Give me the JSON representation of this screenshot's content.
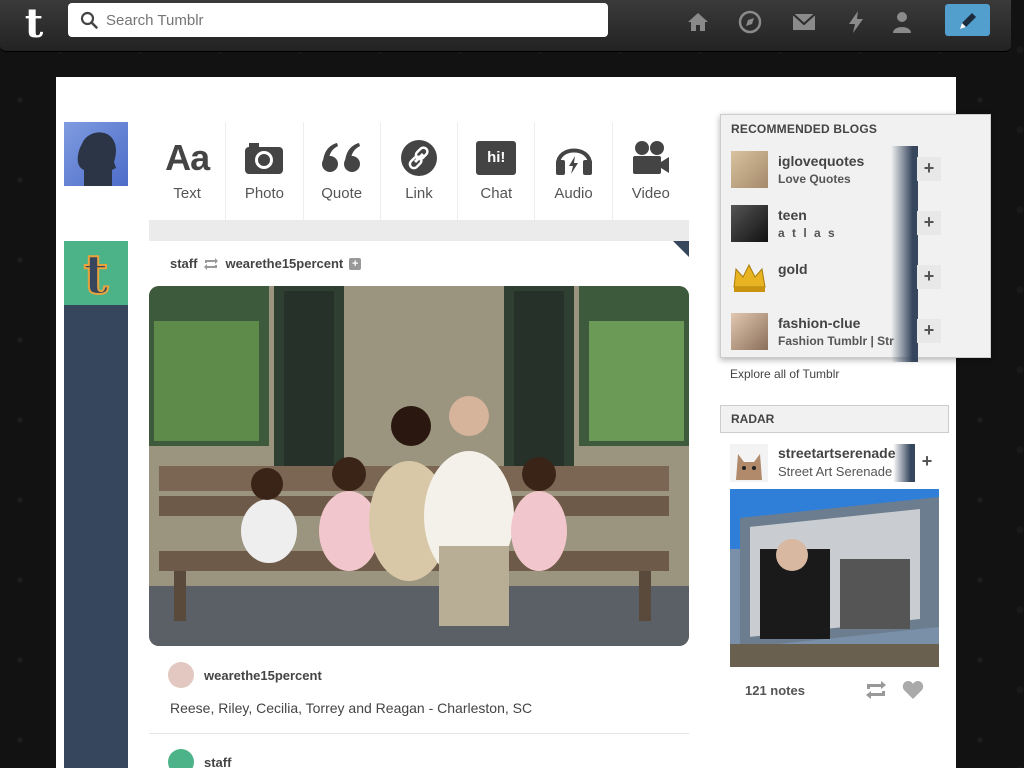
{
  "header": {
    "logo": "t",
    "search_placeholder": "Search Tumblr",
    "nav": [
      "home-icon",
      "explore-icon",
      "inbox-icon",
      "activity-icon",
      "account-icon",
      "compose-icon"
    ]
  },
  "post_types": [
    {
      "label": "Text",
      "icon": "text-icon"
    },
    {
      "label": "Photo",
      "icon": "camera-icon"
    },
    {
      "label": "Quote",
      "icon": "quote-icon"
    },
    {
      "label": "Link",
      "icon": "link-icon"
    },
    {
      "label": "Chat",
      "icon": "chat-icon"
    },
    {
      "label": "Audio",
      "icon": "headphones-icon"
    },
    {
      "label": "Video",
      "icon": "video-camera-icon"
    }
  ],
  "post_type_glyphs": {
    "text": "Aa",
    "chat": "hi!"
  },
  "post": {
    "reblogger": "staff",
    "source": "wearethe15percent",
    "author": "wearethe15percent",
    "caption": "Reese, Riley, Cecilia, Torrey and Reagan - Charleston, SC"
  },
  "next_post": {
    "author": "staff"
  },
  "recommended": {
    "title": "RECOMMENDED BLOGS",
    "items": [
      {
        "name": "iglovequotes",
        "subtitle": "Love Quotes"
      },
      {
        "name": "teen",
        "subtitle": "a t l a s"
      },
      {
        "name": "gold",
        "subtitle": ""
      },
      {
        "name": "fashion-clue",
        "subtitle": "Fashion Tumblr | Str"
      }
    ],
    "follow_glyph": "+",
    "explore_link": "Explore all of Tumblr"
  },
  "radar": {
    "title": "RADAR",
    "blog_name": "streetartserenade",
    "blog_subtitle": "Street Art Serenade",
    "follow_glyph": "+",
    "notes": "121 notes"
  },
  "colors": {
    "accent": "#529ecc",
    "navy": "#36465d",
    "staff_green": "#4cb389"
  }
}
